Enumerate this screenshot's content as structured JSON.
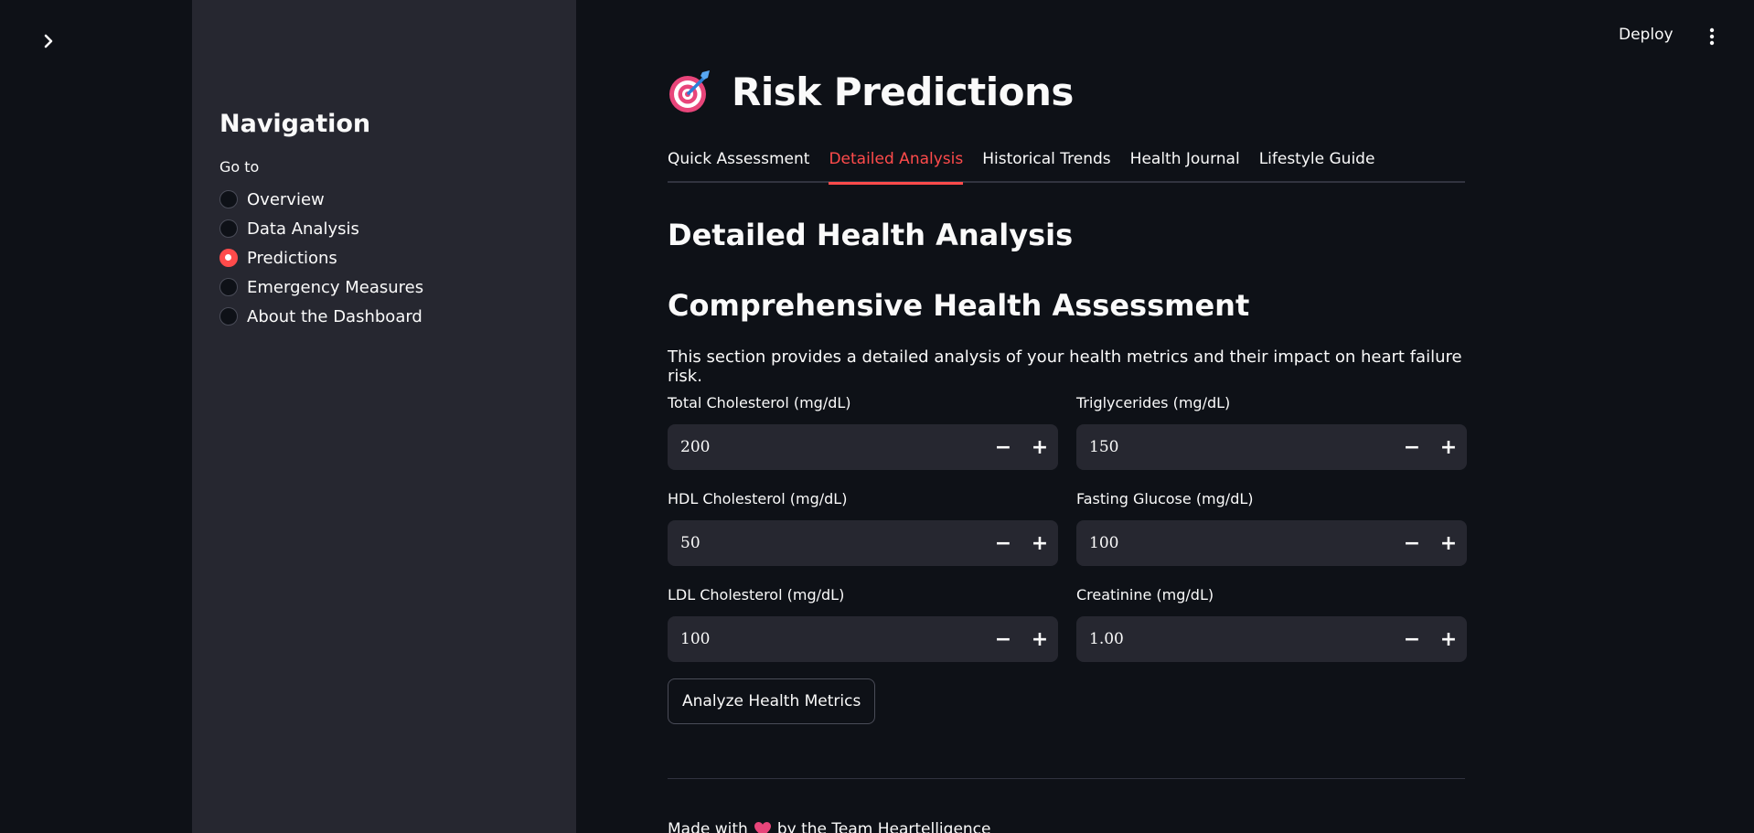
{
  "header": {
    "deploy_label": "Deploy"
  },
  "sidebar": {
    "title": "Navigation",
    "subtitle": "Go to",
    "items": [
      {
        "label": "Overview",
        "selected": false
      },
      {
        "label": "Data Analysis",
        "selected": false
      },
      {
        "label": "Predictions",
        "selected": true
      },
      {
        "label": "Emergency Measures",
        "selected": false
      },
      {
        "label": "About the Dashboard",
        "selected": false
      }
    ]
  },
  "main": {
    "title_icon": "dart-target-icon",
    "title": "Risk Predictions",
    "tabs": [
      {
        "label": "Quick Assessment",
        "active": false
      },
      {
        "label": "Detailed Analysis",
        "active": true
      },
      {
        "label": "Historical Trends",
        "active": false
      },
      {
        "label": "Health Journal",
        "active": false
      },
      {
        "label": "Lifestyle Guide",
        "active": false
      }
    ],
    "section_title": "Detailed Health Analysis",
    "subsection_title": "Comprehensive Health Assessment",
    "description": "This section provides a detailed analysis of your health metrics and their impact on heart failure risk.",
    "fields": [
      {
        "label": "Total Cholesterol (mg/dL)",
        "value": "200"
      },
      {
        "label": "Triglycerides (mg/dL)",
        "value": "150"
      },
      {
        "label": "HDL Cholesterol (mg/dL)",
        "value": "50"
      },
      {
        "label": "Fasting Glucose (mg/dL)",
        "value": "100"
      },
      {
        "label": "LDL Cholesterol (mg/dL)",
        "value": "100"
      },
      {
        "label": "Creatinine (mg/dL)",
        "value": "1.00"
      }
    ],
    "stepper_minus": "−",
    "stepper_plus": "+",
    "analyze_button": "Analyze Health Metrics",
    "footer_prefix": "Made with",
    "footer_suffix": "by the Team Heartelligence"
  },
  "colors": {
    "background": "#0e1117",
    "sidebar": "#262730",
    "accent": "#ff4b4b",
    "input_bg": "#262730"
  }
}
